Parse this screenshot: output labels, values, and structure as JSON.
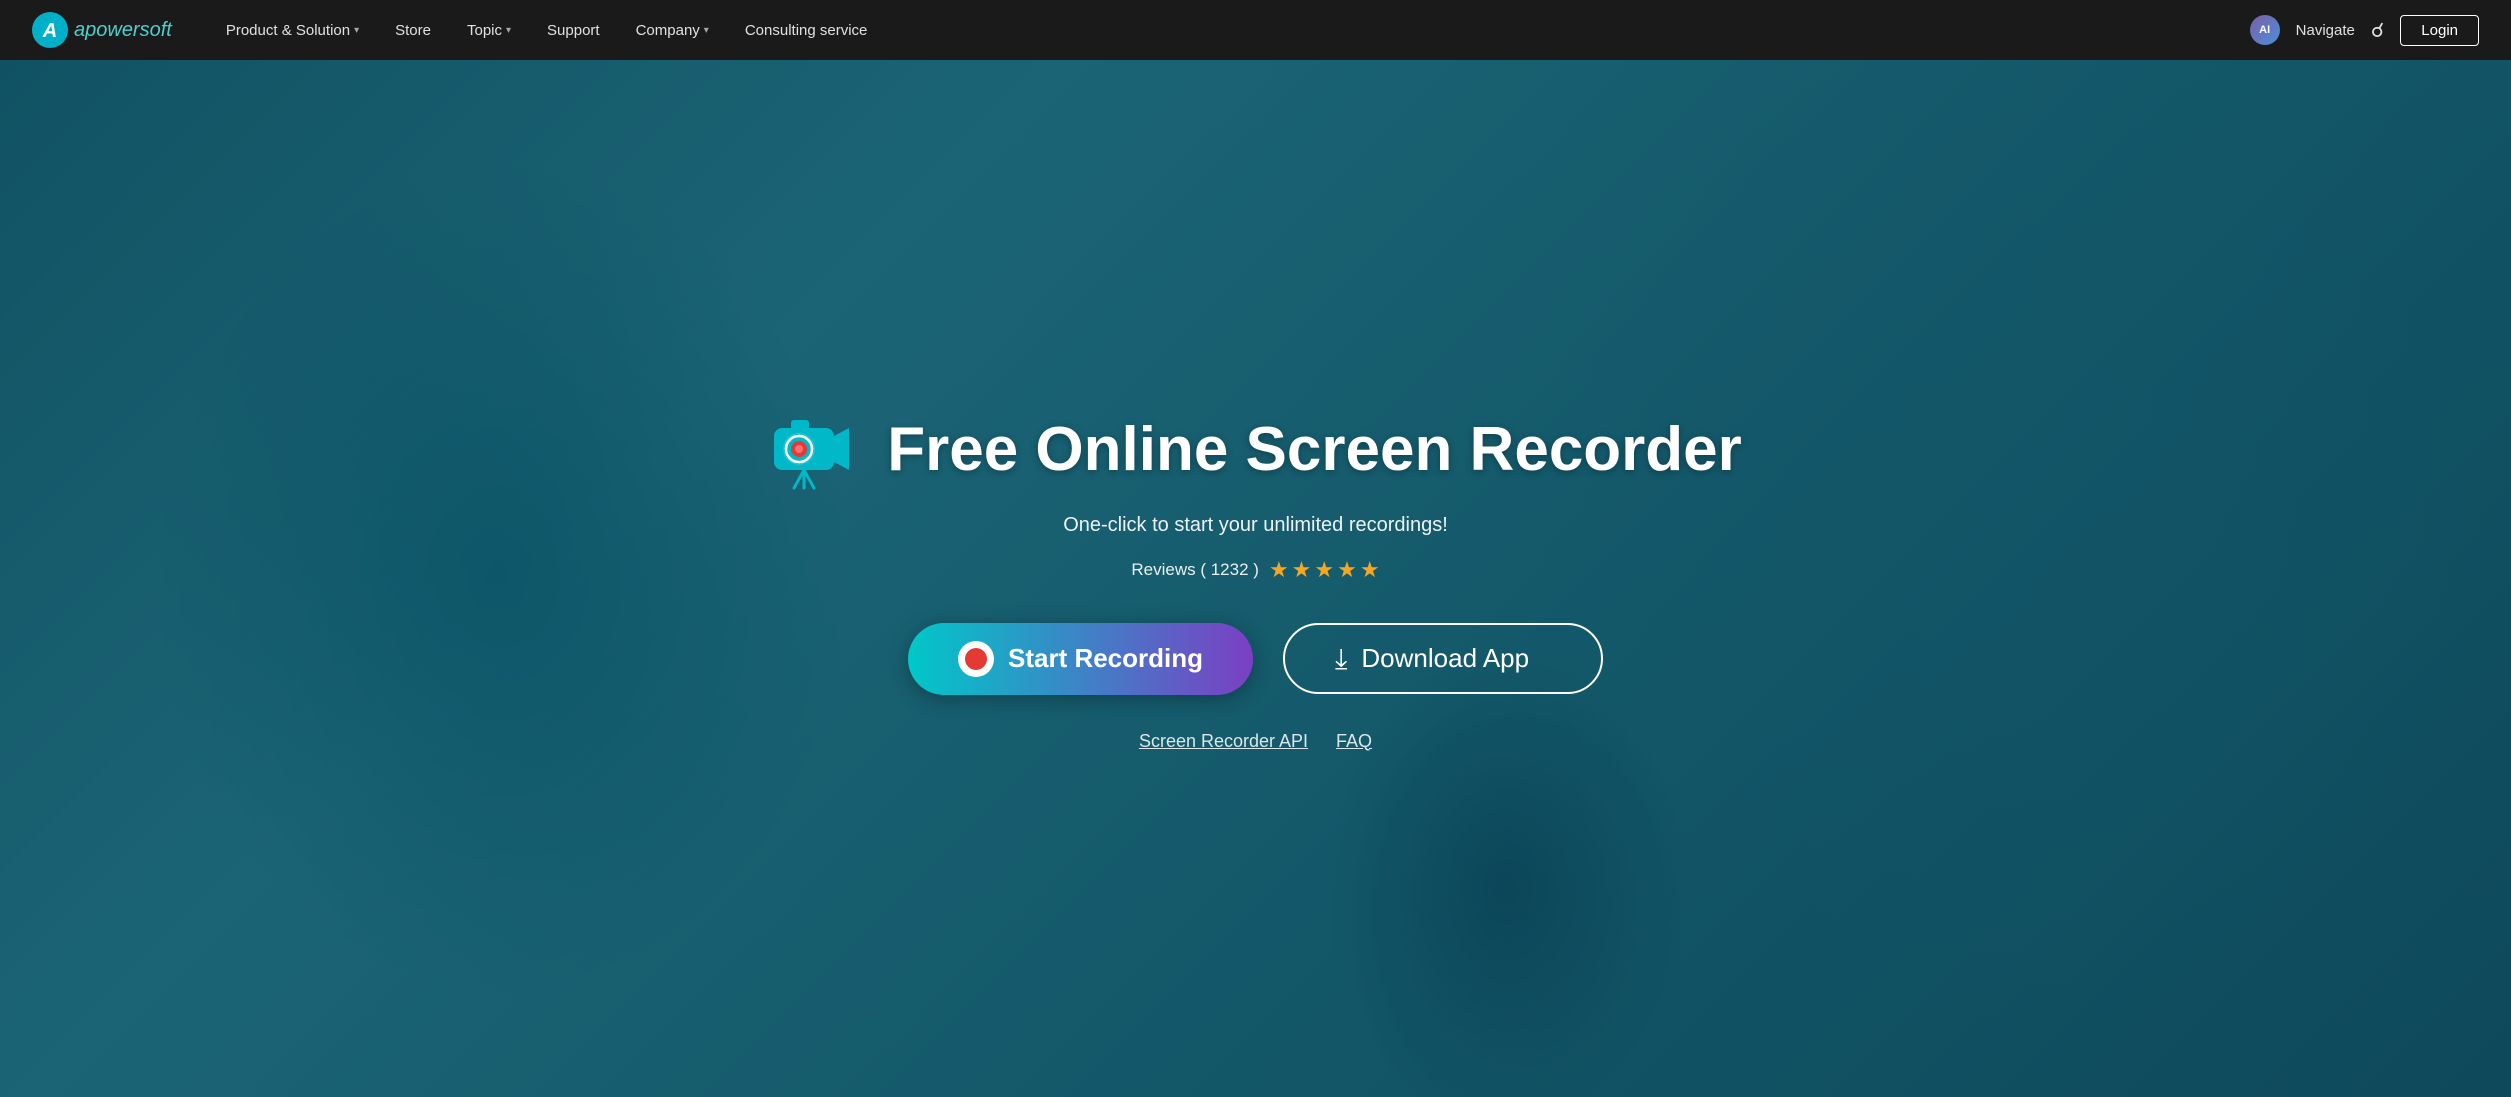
{
  "navbar": {
    "logo_text_a": "a",
    "logo_text_main": "apowersoft",
    "items": [
      {
        "label": "Product & Solution",
        "has_chevron": true
      },
      {
        "label": "Store",
        "has_chevron": false
      },
      {
        "label": "Topic",
        "has_chevron": true
      },
      {
        "label": "Support",
        "has_chevron": false
      },
      {
        "label": "Company",
        "has_chevron": true
      },
      {
        "label": "Consulting service",
        "has_chevron": false
      }
    ],
    "ai_badge": "AI",
    "navigate_label": "Navigate",
    "login_label": "Login"
  },
  "hero": {
    "title": "Free Online Screen Recorder",
    "subtitle": "One-click to start your unlimited recordings!",
    "reviews_label": "Reviews ( 1232 )",
    "stars_count": 5,
    "btn_start": "Start Recording",
    "btn_download": "Download App",
    "link1": "Screen Recorder API",
    "link2": "FAQ"
  }
}
